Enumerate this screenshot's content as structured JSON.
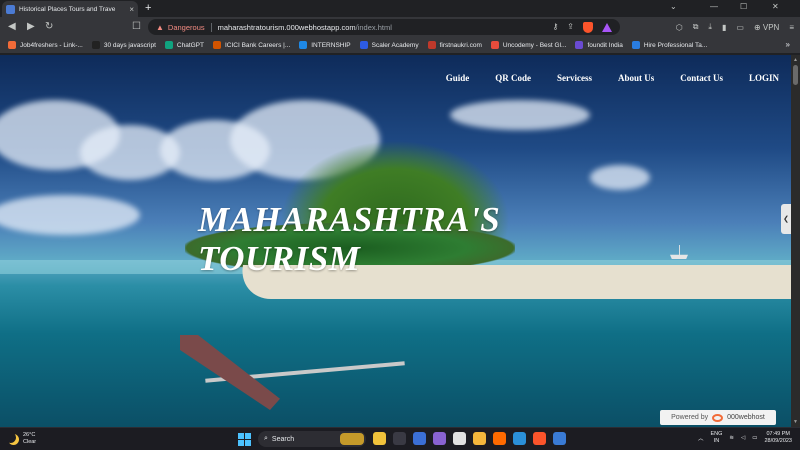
{
  "browser": {
    "tab": {
      "title": "Historical Places Tours and Trave",
      "close": "×"
    },
    "new_tab": "+",
    "window_controls": {
      "minimize": "⌄",
      "min": "—",
      "max": "☐",
      "close": "✕"
    },
    "nav": {
      "back": "◀",
      "forward": "▶",
      "reload": "↻",
      "bookmark": "☐"
    },
    "omnibox": {
      "security_label": "Dangerous",
      "url_host": "maharashtratourism.000webhostapp.com",
      "url_path": "/index.html"
    },
    "vpn_label": "VPN",
    "bookmarks": [
      {
        "label": "Job4freshers - Link-...",
        "color": "#f26b38"
      },
      {
        "label": "30 days javascript",
        "color": "#222222"
      },
      {
        "label": "ChatGPT",
        "color": "#10a37f"
      },
      {
        "label": "ICICI Bank Careers |...",
        "color": "#d35400"
      },
      {
        "label": "INTERNSHIP",
        "color": "#1e88e5"
      },
      {
        "label": "Scaler Academy",
        "color": "#2d5be3"
      },
      {
        "label": "firstnaukri.com",
        "color": "#c0392b"
      },
      {
        "label": "Uncodemy - Best Gl...",
        "color": "#e74c3c"
      },
      {
        "label": "foundit India",
        "color": "#6a4bd3"
      },
      {
        "label": "Hire Professional Ta...",
        "color": "#2a7de1"
      }
    ],
    "bookmarks_more": "»"
  },
  "site": {
    "nav": [
      "Guide",
      "QR Code",
      "Servicess",
      "About Us",
      "Contact Us",
      "LOGIN"
    ],
    "hero_line1": "MAHARASHTRA'S",
    "hero_line2": "TOURISM",
    "powered_prefix": "Powered by",
    "powered_brand": "000webhost",
    "side_handle": "❮"
  },
  "taskbar": {
    "weather_temp": "26°C",
    "weather_cond": "Clear",
    "search_placeholder": "Search",
    "apps": [
      "#f0c23b",
      "#3a3a44",
      "#3b6fd6",
      "#8a63d2",
      "#e2e2e2",
      "#f6b73c",
      "#ff6a00",
      "#2b90d9",
      "#fb542b",
      "#3a7bd5"
    ],
    "language": "ENG",
    "region": "IN",
    "time": "07:49 PM",
    "date": "28/09/2023"
  }
}
